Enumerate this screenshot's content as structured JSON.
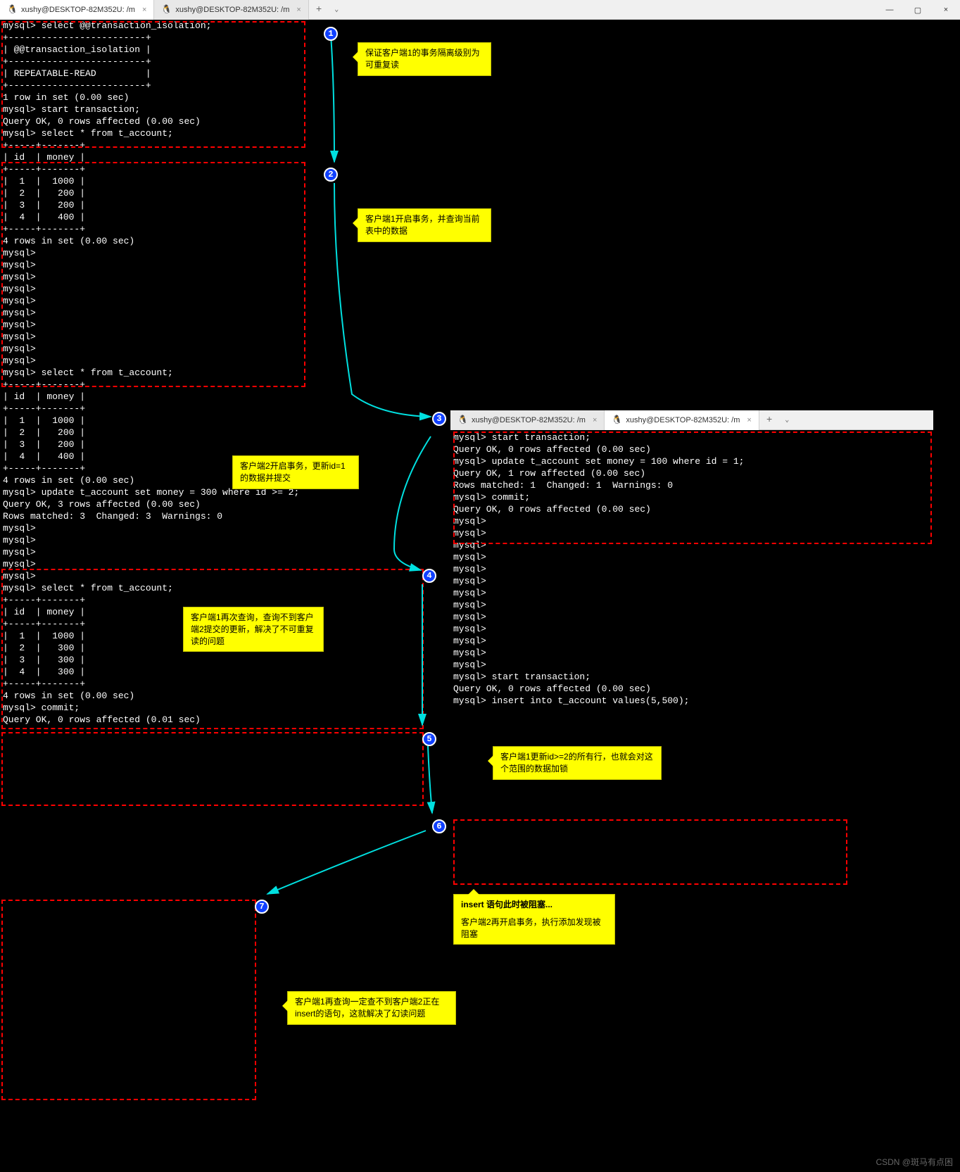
{
  "titlebar1": {
    "tab1": "xushy@DESKTOP-82M352U: /m",
    "tab2": "xushy@DESKTOP-82M352U: /m",
    "plus": "+",
    "chev": "⌄",
    "min": "—",
    "max": "▢",
    "close": "×"
  },
  "titlebar2": {
    "tab1": "xushy@DESKTOP-82M352U: /m",
    "tab2": "xushy@DESKTOP-82M352U: /m",
    "plus": "+",
    "chev": "⌄"
  },
  "term1": {
    "l01": "mysql> select @@transaction_isolation;",
    "l02": "+-------------------------+",
    "l03": "| @@transaction_isolation |",
    "l04": "+-------------------------+",
    "l05": "| REPEATABLE-READ         |",
    "l06": "+-------------------------+",
    "l07": "1 row in set (0.00 sec)",
    "l08": "",
    "l09": "mysql> start transaction;",
    "l10": "Query OK, 0 rows affected (0.00 sec)",
    "l11": "",
    "l12": "mysql> select * from t_account;",
    "l13": "+-----+-------+",
    "l14": "| id  | money |",
    "l15": "+-----+-------+",
    "l16": "|  1  |  1000 |",
    "l17": "|  2  |   200 |",
    "l18": "|  3  |   200 |",
    "l19": "|  4  |   400 |",
    "l20": "+-----+-------+",
    "l21": "4 rows in set (0.00 sec)",
    "l22": "",
    "l23": "mysql>",
    "l24": "mysql>",
    "l25": "mysql>",
    "l26": "mysql>",
    "l27": "mysql>",
    "l28": "mysql>",
    "l29": "mysql>",
    "l30": "mysql>",
    "l31": "mysql>",
    "l32": "mysql>",
    "l33": "mysql> select * from t_account;",
    "l34": "+-----+-------+",
    "l35": "| id  | money |",
    "l36": "+-----+-------+",
    "l37": "|  1  |  1000 |",
    "l38": "|  2  |   200 |",
    "l39": "|  3  |   200 |",
    "l40": "|  4  |   400 |",
    "l41": "+-----+-------+",
    "l42": "4 rows in set (0.00 sec)",
    "l43": "",
    "l44": "mysql> update t_account set money = 300 where id >= 2;",
    "l45": "Query OK, 3 rows affected (0.00 sec)",
    "l46": "Rows matched: 3  Changed: 3  Warnings: 0",
    "l47": "",
    "l48": "mysql>",
    "l49": "mysql>",
    "l50": "mysql>",
    "l51": "mysql>",
    "l52": "mysql>",
    "l53": "mysql> select * from t_account;",
    "l54": "+-----+-------+",
    "l55": "| id  | money |",
    "l56": "+-----+-------+",
    "l57": "|  1  |  1000 |",
    "l58": "|  2  |   300 |",
    "l59": "|  3  |   300 |",
    "l60": "|  4  |   300 |",
    "l61": "+-----+-------+",
    "l62": "4 rows in set (0.00 sec)",
    "l63": "",
    "l64": "mysql> commit;",
    "l65": "Query OK, 0 rows affected (0.01 sec)"
  },
  "term2": {
    "l01": "mysql> start transaction;",
    "l02": "Query OK, 0 rows affected (0.00 sec)",
    "l03": "",
    "l04": "mysql> update t_account set money = 100 where id = 1;",
    "l05": "Query OK, 1 row affected (0.00 sec)",
    "l06": "Rows matched: 1  Changed: 1  Warnings: 0",
    "l07": "",
    "l08": "mysql> commit;",
    "l09": "Query OK, 0 rows affected (0.00 sec)",
    "l10": "",
    "l11": "mysql>",
    "l12": "mysql>",
    "l13": "mysql>",
    "l14": "mysql>",
    "l15": "mysql>",
    "l16": "mysql>",
    "l17": "mysql>",
    "l18": "mysql>",
    "l19": "mysql>",
    "l20": "mysql>",
    "l21": "mysql>",
    "l22": "mysql>",
    "l23": "mysql>",
    "l24": "mysql> start transaction;",
    "l25": "Query OK, 0 rows affected (0.00 sec)",
    "l26": "",
    "l27": "mysql> insert into t_account values(5,500);"
  },
  "notes": {
    "n1": "保证客户端1的事务隔离级别为可重复读",
    "n2": "客户端1开启事务，并查询当前表中的数据",
    "n3": "客户端2开启事务，更新id=1的数据并提交",
    "n4": "客户端1再次查询，查询不到客户端2提交的更新，解决了不可重复读的问题",
    "n5": "客户端1更新id>=2的所有行，也就会对这个范围的数据加锁",
    "n6a": "insert 语句此时被阻塞...",
    "n6b": "客户端2再开启事务，执行添加发现被阻塞",
    "n7": "客户端1再查询一定查不到客户端2正在insert的语句，这就解决了幻读问题"
  },
  "badges": {
    "b1": "1",
    "b2": "2",
    "b3": "3",
    "b4": "4",
    "b5": "5",
    "b6": "6",
    "b7": "7"
  },
  "watermark": "CSDN @斑马有点困"
}
